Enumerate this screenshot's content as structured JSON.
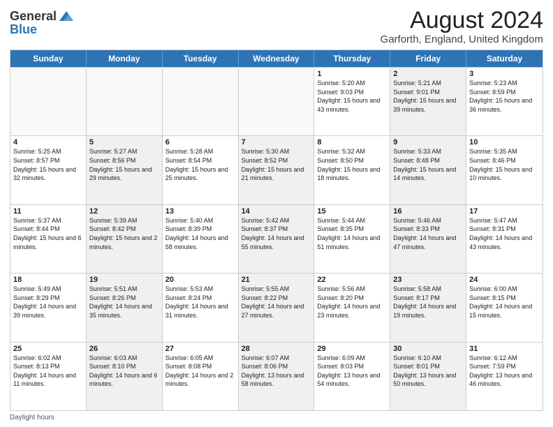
{
  "header": {
    "logo_general": "General",
    "logo_blue": "Blue",
    "month_year": "August 2024",
    "location": "Garforth, England, United Kingdom"
  },
  "days_of_week": [
    "Sunday",
    "Monday",
    "Tuesday",
    "Wednesday",
    "Thursday",
    "Friday",
    "Saturday"
  ],
  "footer": {
    "daylight_label": "Daylight hours"
  },
  "weeks": [
    [
      {
        "day": "",
        "sunrise": "",
        "sunset": "",
        "daylight": "",
        "shaded": false,
        "empty": true
      },
      {
        "day": "",
        "sunrise": "",
        "sunset": "",
        "daylight": "",
        "shaded": false,
        "empty": true
      },
      {
        "day": "",
        "sunrise": "",
        "sunset": "",
        "daylight": "",
        "shaded": false,
        "empty": true
      },
      {
        "day": "",
        "sunrise": "",
        "sunset": "",
        "daylight": "",
        "shaded": false,
        "empty": true
      },
      {
        "day": "1",
        "sunrise": "Sunrise: 5:20 AM",
        "sunset": "Sunset: 9:03 PM",
        "daylight": "Daylight: 15 hours and 43 minutes.",
        "shaded": false,
        "empty": false
      },
      {
        "day": "2",
        "sunrise": "Sunrise: 5:21 AM",
        "sunset": "Sunset: 9:01 PM",
        "daylight": "Daylight: 15 hours and 39 minutes.",
        "shaded": true,
        "empty": false
      },
      {
        "day": "3",
        "sunrise": "Sunrise: 5:23 AM",
        "sunset": "Sunset: 8:59 PM",
        "daylight": "Daylight: 15 hours and 36 minutes.",
        "shaded": false,
        "empty": false
      }
    ],
    [
      {
        "day": "4",
        "sunrise": "Sunrise: 5:25 AM",
        "sunset": "Sunset: 8:57 PM",
        "daylight": "Daylight: 15 hours and 32 minutes.",
        "shaded": false,
        "empty": false
      },
      {
        "day": "5",
        "sunrise": "Sunrise: 5:27 AM",
        "sunset": "Sunset: 8:56 PM",
        "daylight": "Daylight: 15 hours and 29 minutes.",
        "shaded": true,
        "empty": false
      },
      {
        "day": "6",
        "sunrise": "Sunrise: 5:28 AM",
        "sunset": "Sunset: 8:54 PM",
        "daylight": "Daylight: 15 hours and 25 minutes.",
        "shaded": false,
        "empty": false
      },
      {
        "day": "7",
        "sunrise": "Sunrise: 5:30 AM",
        "sunset": "Sunset: 8:52 PM",
        "daylight": "Daylight: 15 hours and 21 minutes.",
        "shaded": true,
        "empty": false
      },
      {
        "day": "8",
        "sunrise": "Sunrise: 5:32 AM",
        "sunset": "Sunset: 8:50 PM",
        "daylight": "Daylight: 15 hours and 18 minutes.",
        "shaded": false,
        "empty": false
      },
      {
        "day": "9",
        "sunrise": "Sunrise: 5:33 AM",
        "sunset": "Sunset: 8:48 PM",
        "daylight": "Daylight: 15 hours and 14 minutes.",
        "shaded": true,
        "empty": false
      },
      {
        "day": "10",
        "sunrise": "Sunrise: 5:35 AM",
        "sunset": "Sunset: 8:46 PM",
        "daylight": "Daylight: 15 hours and 10 minutes.",
        "shaded": false,
        "empty": false
      }
    ],
    [
      {
        "day": "11",
        "sunrise": "Sunrise: 5:37 AM",
        "sunset": "Sunset: 8:44 PM",
        "daylight": "Daylight: 15 hours and 6 minutes.",
        "shaded": false,
        "empty": false
      },
      {
        "day": "12",
        "sunrise": "Sunrise: 5:39 AM",
        "sunset": "Sunset: 8:42 PM",
        "daylight": "Daylight: 15 hours and 2 minutes.",
        "shaded": true,
        "empty": false
      },
      {
        "day": "13",
        "sunrise": "Sunrise: 5:40 AM",
        "sunset": "Sunset: 8:39 PM",
        "daylight": "Daylight: 14 hours and 58 minutes.",
        "shaded": false,
        "empty": false
      },
      {
        "day": "14",
        "sunrise": "Sunrise: 5:42 AM",
        "sunset": "Sunset: 8:37 PM",
        "daylight": "Daylight: 14 hours and 55 minutes.",
        "shaded": true,
        "empty": false
      },
      {
        "day": "15",
        "sunrise": "Sunrise: 5:44 AM",
        "sunset": "Sunset: 8:35 PM",
        "daylight": "Daylight: 14 hours and 51 minutes.",
        "shaded": false,
        "empty": false
      },
      {
        "day": "16",
        "sunrise": "Sunrise: 5:46 AM",
        "sunset": "Sunset: 8:33 PM",
        "daylight": "Daylight: 14 hours and 47 minutes.",
        "shaded": true,
        "empty": false
      },
      {
        "day": "17",
        "sunrise": "Sunrise: 5:47 AM",
        "sunset": "Sunset: 8:31 PM",
        "daylight": "Daylight: 14 hours and 43 minutes.",
        "shaded": false,
        "empty": false
      }
    ],
    [
      {
        "day": "18",
        "sunrise": "Sunrise: 5:49 AM",
        "sunset": "Sunset: 8:29 PM",
        "daylight": "Daylight: 14 hours and 39 minutes.",
        "shaded": false,
        "empty": false
      },
      {
        "day": "19",
        "sunrise": "Sunrise: 5:51 AM",
        "sunset": "Sunset: 8:26 PM",
        "daylight": "Daylight: 14 hours and 35 minutes.",
        "shaded": true,
        "empty": false
      },
      {
        "day": "20",
        "sunrise": "Sunrise: 5:53 AM",
        "sunset": "Sunset: 8:24 PM",
        "daylight": "Daylight: 14 hours and 31 minutes.",
        "shaded": false,
        "empty": false
      },
      {
        "day": "21",
        "sunrise": "Sunrise: 5:55 AM",
        "sunset": "Sunset: 8:22 PM",
        "daylight": "Daylight: 14 hours and 27 minutes.",
        "shaded": true,
        "empty": false
      },
      {
        "day": "22",
        "sunrise": "Sunrise: 5:56 AM",
        "sunset": "Sunset: 8:20 PM",
        "daylight": "Daylight: 14 hours and 23 minutes.",
        "shaded": false,
        "empty": false
      },
      {
        "day": "23",
        "sunrise": "Sunrise: 5:58 AM",
        "sunset": "Sunset: 8:17 PM",
        "daylight": "Daylight: 14 hours and 19 minutes.",
        "shaded": true,
        "empty": false
      },
      {
        "day": "24",
        "sunrise": "Sunrise: 6:00 AM",
        "sunset": "Sunset: 8:15 PM",
        "daylight": "Daylight: 14 hours and 15 minutes.",
        "shaded": false,
        "empty": false
      }
    ],
    [
      {
        "day": "25",
        "sunrise": "Sunrise: 6:02 AM",
        "sunset": "Sunset: 8:13 PM",
        "daylight": "Daylight: 14 hours and 11 minutes.",
        "shaded": false,
        "empty": false
      },
      {
        "day": "26",
        "sunrise": "Sunrise: 6:03 AM",
        "sunset": "Sunset: 8:10 PM",
        "daylight": "Daylight: 14 hours and 6 minutes.",
        "shaded": true,
        "empty": false
      },
      {
        "day": "27",
        "sunrise": "Sunrise: 6:05 AM",
        "sunset": "Sunset: 8:08 PM",
        "daylight": "Daylight: 14 hours and 2 minutes.",
        "shaded": false,
        "empty": false
      },
      {
        "day": "28",
        "sunrise": "Sunrise: 6:07 AM",
        "sunset": "Sunset: 8:06 PM",
        "daylight": "Daylight: 13 hours and 58 minutes.",
        "shaded": true,
        "empty": false
      },
      {
        "day": "29",
        "sunrise": "Sunrise: 6:09 AM",
        "sunset": "Sunset: 8:03 PM",
        "daylight": "Daylight: 13 hours and 54 minutes.",
        "shaded": false,
        "empty": false
      },
      {
        "day": "30",
        "sunrise": "Sunrise: 6:10 AM",
        "sunset": "Sunset: 8:01 PM",
        "daylight": "Daylight: 13 hours and 50 minutes.",
        "shaded": true,
        "empty": false
      },
      {
        "day": "31",
        "sunrise": "Sunrise: 6:12 AM",
        "sunset": "Sunset: 7:59 PM",
        "daylight": "Daylight: 13 hours and 46 minutes.",
        "shaded": false,
        "empty": false
      }
    ]
  ]
}
